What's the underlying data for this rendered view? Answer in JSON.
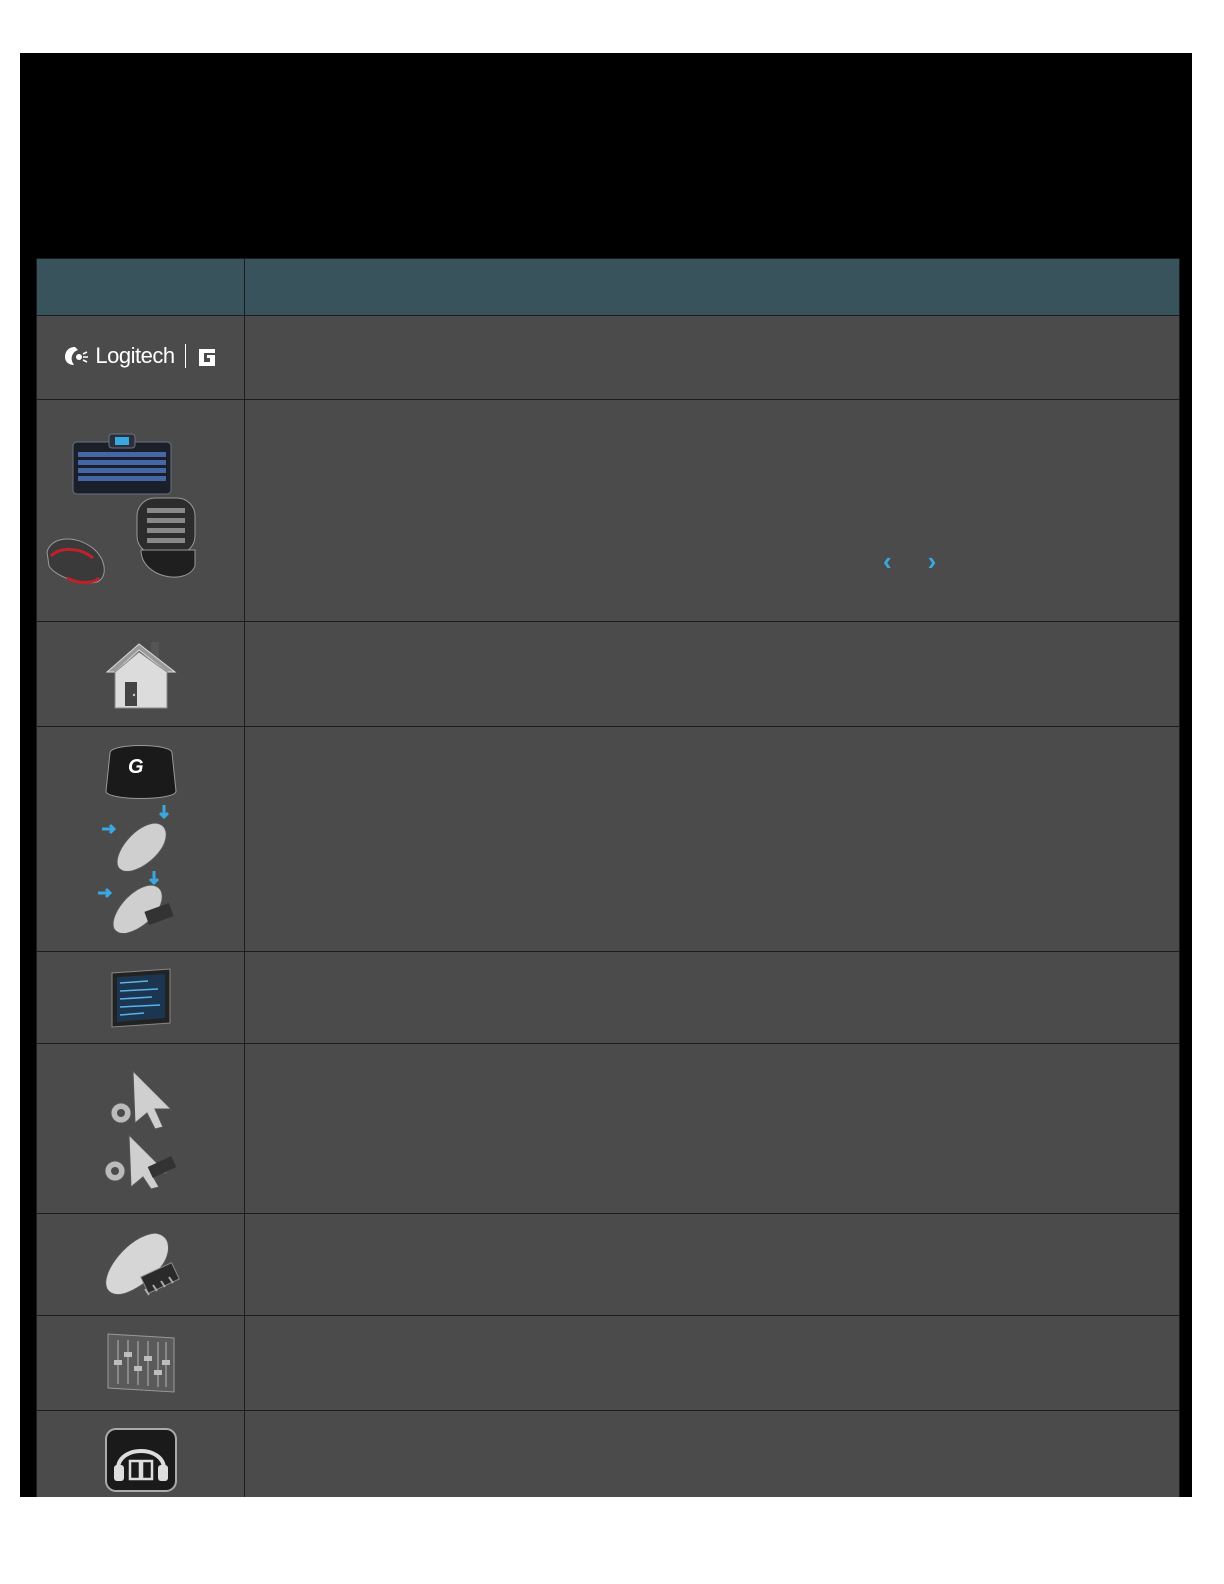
{
  "header": {
    "col1": "",
    "col2": ""
  },
  "rows": [
    {
      "icon": "logitech-g-logo",
      "brand": "Logitech",
      "desc": ""
    },
    {
      "icon": "gaming-devices-icon",
      "desc": ""
    },
    {
      "icon": "home-icon",
      "desc": ""
    },
    {
      "icon": "g-key-mouse-assign-icon",
      "desc": ""
    },
    {
      "icon": "lcd-screen-icon",
      "desc": ""
    },
    {
      "icon": "pointer-settings-icon",
      "desc": ""
    },
    {
      "icon": "onboard-memory-mouse-icon",
      "desc": ""
    },
    {
      "icon": "equalizer-icon",
      "desc": ""
    },
    {
      "icon": "headset-surround-icon",
      "desc": ""
    }
  ],
  "nav": {
    "prev": "‹",
    "next": "›"
  },
  "colors": {
    "header": "#38535c",
    "row": "#4b4b4b",
    "accent": "#3aa8e0"
  }
}
